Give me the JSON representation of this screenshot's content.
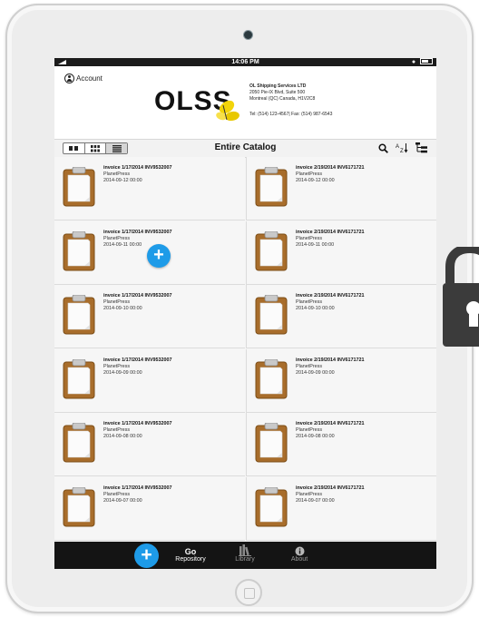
{
  "status_bar": {
    "time": "14:06 PM"
  },
  "header": {
    "account_label": "Account",
    "logo_text": "OLSS",
    "company": {
      "name": "OL Shipping Services LTD",
      "address1": "2050 Pie-IX Blvd, Suite 500",
      "address2": "Montreal (QC) Canada, H1V2C8",
      "contact": "Tel: (514) 123-4567| Fax: (514) 987-6543"
    }
  },
  "toolbar": {
    "title": "Entire Catalog",
    "view_modes": [
      "list-view",
      "grid-view",
      "detail-view"
    ],
    "active_view": "detail-view",
    "icons": [
      "search-icon",
      "sort-az-icon",
      "hierarchy-icon"
    ]
  },
  "documents": [
    {
      "title": "invoice  1/17/2014 INV9532007",
      "source": "PlanetPress",
      "date": "2014-09-12 00:00"
    },
    {
      "title": "invoice  2/19/2014 INV6171721",
      "source": "PlanetPress",
      "date": "2014-09-12 00:00"
    },
    {
      "title": "invoice  1/17/2014 INV9532007",
      "source": "PlanetPress",
      "date": "2014-09-11 00:00"
    },
    {
      "title": "invoice  2/19/2014 INV6171721",
      "source": "PlanetPress",
      "date": "2014-09-11 00:00"
    },
    {
      "title": "invoice  1/17/2014 INV9532007",
      "source": "PlanetPress",
      "date": "2014-09-10 00:00"
    },
    {
      "title": "invoice  2/19/2014 INV6171721",
      "source": "PlanetPress",
      "date": "2014-09-10 00:00"
    },
    {
      "title": "invoice  1/17/2014 INV9532007",
      "source": "PlanetPress",
      "date": "2014-09-09 00:00"
    },
    {
      "title": "invoice  2/19/2014 INV6171721",
      "source": "PlanetPress",
      "date": "2014-09-09 00:00"
    },
    {
      "title": "invoice  1/17/2014 INV9532007",
      "source": "PlanetPress",
      "date": "2014-09-08 00:00"
    },
    {
      "title": "invoice  2/19/2014 INV6171721",
      "source": "PlanetPress",
      "date": "2014-09-08 00:00"
    },
    {
      "title": "invoice  1/17/2014 INV9532007",
      "source": "PlanetPress",
      "date": "2014-09-07 00:00"
    },
    {
      "title": "invoice  2/19/2014 INV6171721",
      "source": "PlanetPress",
      "date": "2014-09-07 00:00"
    }
  ],
  "fab": {
    "label": "+"
  },
  "bottom_bar": {
    "tabs": [
      {
        "icon": "Go",
        "label": "Repository",
        "active": true
      },
      {
        "icon": "library-icon",
        "label": "Library",
        "active": false
      },
      {
        "icon": "info-icon",
        "label": "About",
        "active": false
      }
    ]
  },
  "colors": {
    "accent": "#1e9be8",
    "clipboard": "#a86d2b",
    "logo_yellow": "#f2d40a",
    "bar": "#141414"
  }
}
